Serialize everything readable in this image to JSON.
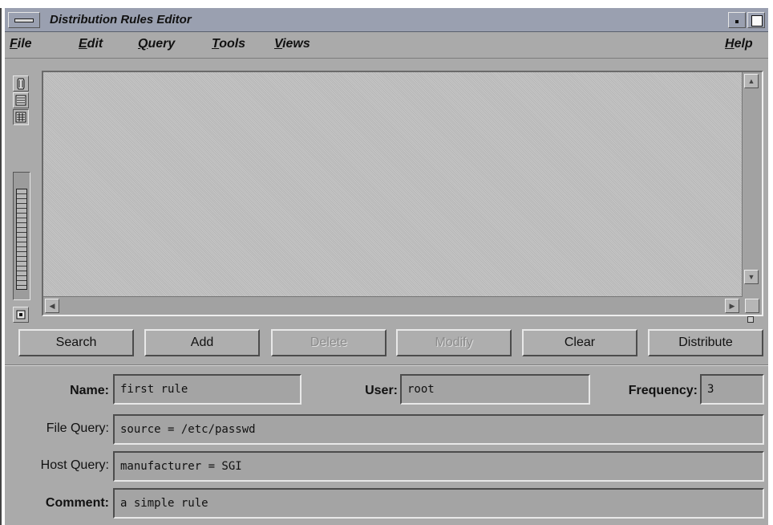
{
  "window": {
    "title": "Distribution Rules Editor"
  },
  "menubar": {
    "items": [
      "File",
      "Edit",
      "Query",
      "Tools",
      "Views"
    ],
    "help": "Help"
  },
  "toolbar": {
    "icons": [
      "object-view-icon",
      "list-view-icon",
      "table-view-icon"
    ],
    "zoom_icon": "zoom-slider-icon",
    "overview_icon": "overview-icon"
  },
  "actions": {
    "search": "Search",
    "add": "Add",
    "delete": "Delete",
    "modify": "Modify",
    "clear": "Clear",
    "distribute": "Distribute",
    "disabled": [
      "delete",
      "modify"
    ]
  },
  "form": {
    "name_label": "Name:",
    "name_value": "first rule",
    "user_label": "User:",
    "user_value": "root",
    "frequency_label": "Frequency:",
    "frequency_value": "3",
    "file_query_label": "File Query:",
    "file_query_value": "source = /etc/passwd",
    "host_query_label": "Host Query:",
    "host_query_value": "manufacturer = SGI",
    "comment_label": "Comment:",
    "comment_value": "a simple rule"
  },
  "colors": {
    "window_bg": "#aaaaaa",
    "titlebar_bg": "#9aa0b0",
    "field_bg": "#a4a4a4"
  }
}
